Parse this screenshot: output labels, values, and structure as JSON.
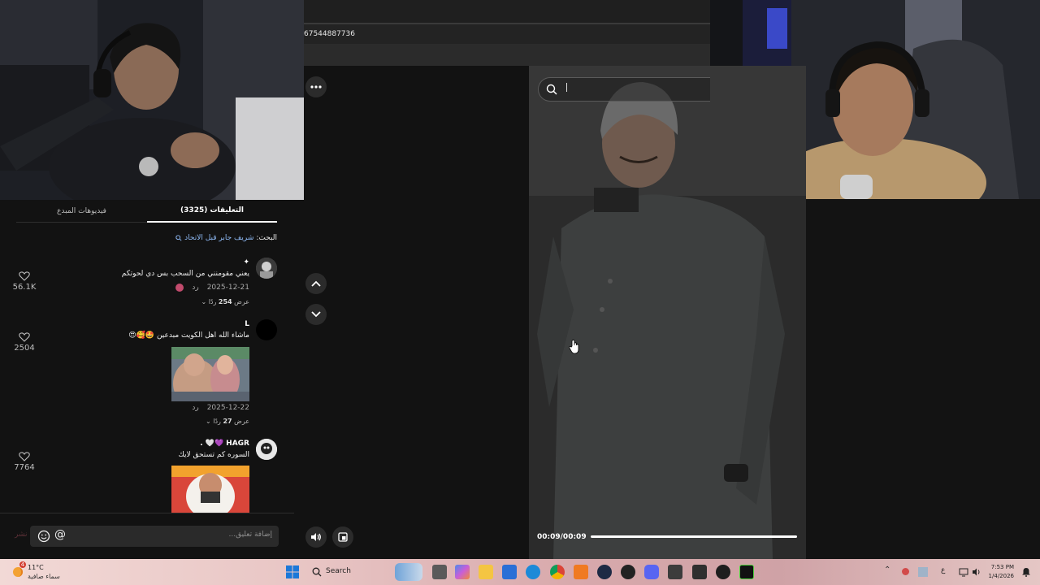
{
  "browser": {
    "url_text": "67544887736"
  },
  "comments_panel": {
    "tabs": [
      {
        "label": "التعليقات (3325)",
        "active": true
      },
      {
        "label": "فيديوهات المبدع",
        "active": false
      }
    ],
    "search": {
      "label": "البحث:",
      "query": "شريف جابر قبل الاتحاد"
    },
    "comments": [
      {
        "name": "✦",
        "text": "يعني مقومنني من السحب بس دي لحوتكم",
        "date": "2025-12-21",
        "reply_label": "رد",
        "view_replies_prefix": "عرض",
        "view_replies_count": "254",
        "view_replies_suffix": "ردًا",
        "likes": "56.1K"
      },
      {
        "name": "L",
        "text": "ماشاء الله اهل الكويت مبدعين 🤩🥰😍",
        "date": "2025-12-22",
        "reply_label": "رد",
        "view_replies_prefix": "عرض",
        "view_replies_count": "27",
        "view_replies_suffix": "ردًا",
        "likes": "2504"
      },
      {
        "name": "HAGR",
        "name_suffix": "💜🤍 .",
        "text": "السوره كم تستحق لايك",
        "likes": "7764"
      }
    ],
    "input": {
      "placeholder": "إضافة تعليق...",
      "post_label": "نشر"
    }
  },
  "video": {
    "time_label": "00:09/00:09",
    "progress": 1.0
  },
  "taskbar": {
    "weather_temp": "11°C",
    "weather_desc": "سماء صافية",
    "weather_badge": "4",
    "search_label": "Search",
    "time": "7:53 PM",
    "date": "1/4/2026",
    "lang": "ع"
  }
}
